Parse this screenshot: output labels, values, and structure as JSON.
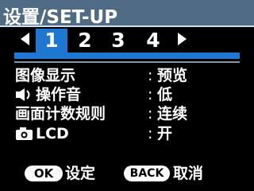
{
  "header": {
    "title": "设置/SET-UP"
  },
  "tabs": {
    "items": [
      "1",
      "2",
      "3",
      "4"
    ],
    "selected": "1"
  },
  "menu": {
    "rows": [
      {
        "label": "图像显示",
        "value": "预览",
        "icon": ""
      },
      {
        "label": "操作音",
        "value": "低",
        "icon": "speaker-icon"
      },
      {
        "label": "画面计数规则",
        "value": "连续",
        "icon": ""
      },
      {
        "label": "LCD",
        "value": "开",
        "icon": "camera-icon"
      }
    ],
    "separator": ":"
  },
  "footer": {
    "ok_key": "OK",
    "ok_label": "设定",
    "back_key": "BACK",
    "back_label": "取消"
  },
  "colors": {
    "header_bg": "#4f6b86",
    "accent_blue": "#1e78d2",
    "background": "#000000",
    "text": "#ffffff"
  }
}
